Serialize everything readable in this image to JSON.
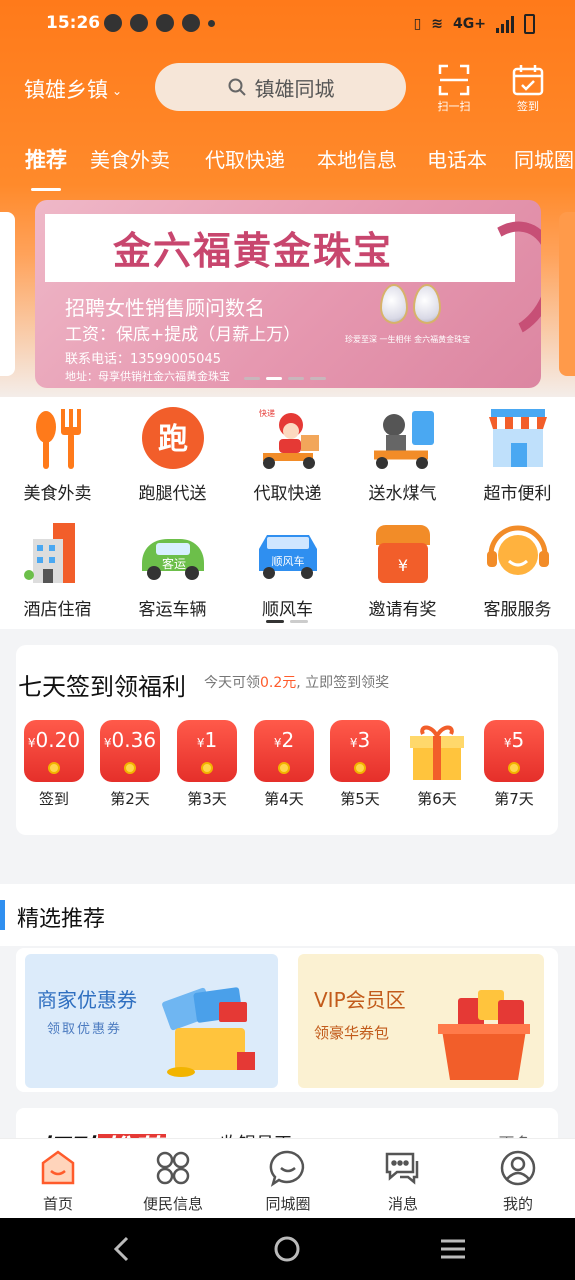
{
  "status": {
    "time": "15:26",
    "network": "4G+"
  },
  "header": {
    "location": "镇雄乡镇",
    "search_placeholder": "镇雄同城",
    "scan_label": "扫一扫",
    "sign_label": "签到"
  },
  "tabs": [
    "推荐",
    "美食外卖",
    "代取快递",
    "本地信息",
    "电话本",
    "同城圈"
  ],
  "banner": {
    "title": "金六福黄金珠宝",
    "line1": "招聘女性销售顾问数名",
    "line2": "工资：保底+提成（月薪上万）",
    "line3": "联系电话：13599005045",
    "line4": "地址：母享供销社金六福黄金珠宝",
    "tiny": "珍爱至深 一生相伴  金六福黄金珠宝"
  },
  "services": [
    {
      "label": "美食外卖",
      "icon": "fork-spoon-icon"
    },
    {
      "label": "跑腿代送",
      "icon": "errand-icon",
      "glyph": "跑"
    },
    {
      "label": "代取快递",
      "icon": "courier-scooter-icon",
      "tag": "快递"
    },
    {
      "label": "送水煤气",
      "icon": "delivery-water-icon"
    },
    {
      "label": "超市便利",
      "icon": "store-icon"
    },
    {
      "label": "酒店住宿",
      "icon": "hotel-icon"
    },
    {
      "label": "客运车辆",
      "icon": "bus-icon",
      "tag": "客运"
    },
    {
      "label": "顺风车",
      "icon": "car-icon",
      "tag": "顺风车"
    },
    {
      "label": "邀请有奖",
      "icon": "invite-bag-icon",
      "glyph": "¥"
    },
    {
      "label": "客服服务",
      "icon": "customer-service-icon"
    }
  ],
  "checkin": {
    "title": "七天签到领福利",
    "sub_prefix": "今天可领",
    "sub_amount": "0.2元",
    "sub_suffix": ", 立即签到领奖",
    "days": [
      {
        "amount": "0.20",
        "label": "签到"
      },
      {
        "amount": "0.36",
        "label": "第2天"
      },
      {
        "amount": "1",
        "label": "第3天"
      },
      {
        "amount": "2",
        "label": "第4天"
      },
      {
        "amount": "3",
        "label": "第5天"
      },
      {
        "amount": "",
        "label": "第6天",
        "gift": true
      },
      {
        "amount": "5",
        "label": "第7天"
      }
    ]
  },
  "featured": {
    "title": "精选推荐",
    "promo_a": {
      "title": "商家优惠券",
      "sub": "领取优惠券"
    },
    "promo_b": {
      "title": "VIP会员区",
      "sub": "领豪华券包"
    }
  },
  "jobs": {
    "title_a": "招聘",
    "title_b": "推荐",
    "middle": "收银员正... ",
    "more": "更多 ›"
  },
  "tabbar": [
    "首页",
    "便民信息",
    "同城圈",
    "消息",
    "我的"
  ],
  "colors": {
    "accent": "#ff7a1a",
    "red": "#e53935",
    "blue": "#2f8ff0"
  }
}
